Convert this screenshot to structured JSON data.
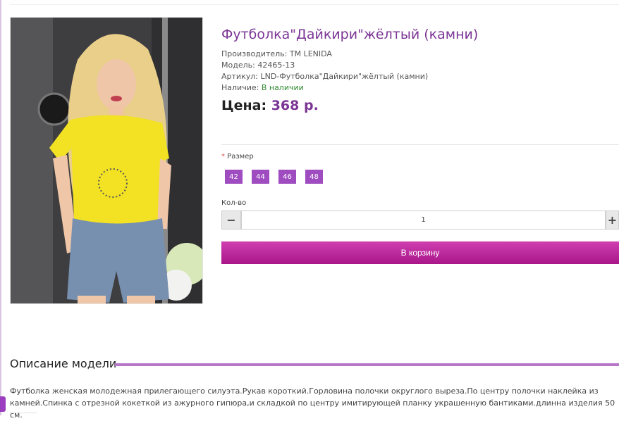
{
  "product": {
    "title": "Футболка\"Дайкири\"жёлтый (камни)",
    "manufacturer_label": "Производитель:",
    "manufacturer": "TM LENIDA",
    "model_label": "Модель:",
    "model": "42465-13",
    "sku_label": "Артикул:",
    "sku": "LND-Футболка\"Дайкири\"жёлтый (камни)",
    "availability_label": "Наличие:",
    "availability": "В наличии",
    "price_label": "Цена:",
    "price": "368 р."
  },
  "options": {
    "size_required_mark": "*",
    "size_label": "Размер",
    "sizes": [
      "42",
      "44",
      "46",
      "48"
    ]
  },
  "quantity": {
    "label": "Кол-во",
    "value": "1",
    "minus": "−",
    "plus": "+"
  },
  "cart": {
    "button_label": "В корзину"
  },
  "description": {
    "heading": "Описание модели",
    "text": "Футболка женская молодежная прилегающего силуэта.Рукав короткий.Горловина полочки округлого выреза.По центру полочки наклейка из камней.Спинка с отрезной кокеткой из ажурного гипюра,и складкой по центру имитирующей планку украшенную бантиками.длинна изделия 50 см."
  },
  "colors": {
    "accent": "#7b3595",
    "size_button": "#9e4cc0",
    "cart_button": "#c02aa0",
    "in_stock": "#2f8a2f",
    "description_line": "#b776c9"
  },
  "icons": {
    "product_image": "product-photo"
  }
}
